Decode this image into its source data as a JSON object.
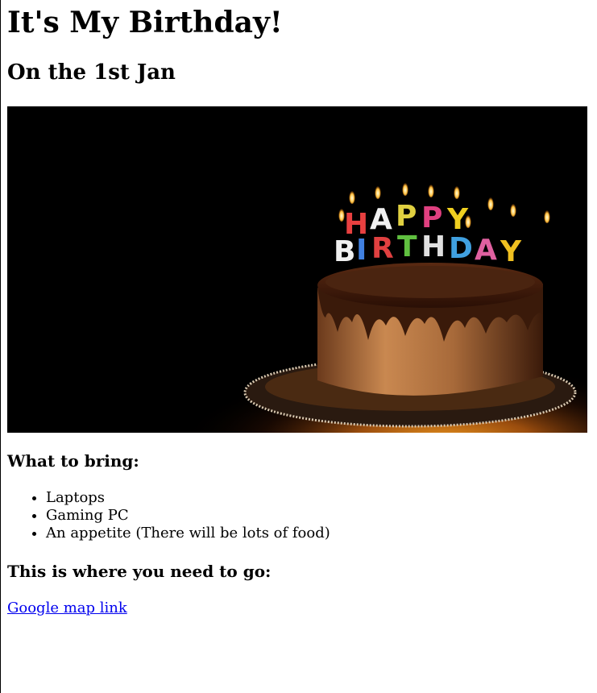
{
  "page": {
    "title": "It's My Birthday!",
    "date_heading": "On the 1st Jan"
  },
  "hero_image": {
    "description_icon": "birthday-cake-icon",
    "candle_letters_top": [
      "H",
      "A",
      "P",
      "P",
      "Y"
    ],
    "candle_letters_bottom": [
      "B",
      "I",
      "R",
      "T",
      "H",
      "D",
      "A",
      "Y"
    ]
  },
  "bring_section": {
    "heading": "What to bring:",
    "items": [
      "Laptops",
      "Gaming PC",
      "An appetite (There will be lots of food)"
    ]
  },
  "location_section": {
    "heading": "This is where you need to go:",
    "link_text": "Google map link"
  },
  "colors": {
    "link": "#0000ee",
    "image_background": "#000000"
  }
}
